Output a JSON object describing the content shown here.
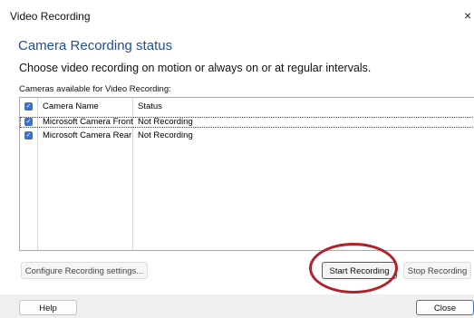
{
  "window": {
    "title": "Video Recording",
    "close_glyph": "×"
  },
  "heading": "Camera Recording status",
  "subheading": "Choose video recording on motion or always on or at regular intervals.",
  "list": {
    "label": "Cameras available for Video Recording:",
    "columns": [
      "Camera Name",
      "Status"
    ],
    "rows": [
      {
        "name": "Microsoft Camera Front",
        "status": "Not Recording",
        "checked": true
      },
      {
        "name": "Microsoft Camera Rear",
        "status": "Not Recording",
        "checked": true
      }
    ]
  },
  "buttons": {
    "configure": "Configure Recording settings...",
    "start": "Start Recording",
    "stop": "Stop Recording",
    "help": "Help",
    "close": "Close"
  },
  "colors": {
    "heading": "#1f4e98",
    "checkbox": "#3b6fd4",
    "highlight": "#b3202a"
  }
}
